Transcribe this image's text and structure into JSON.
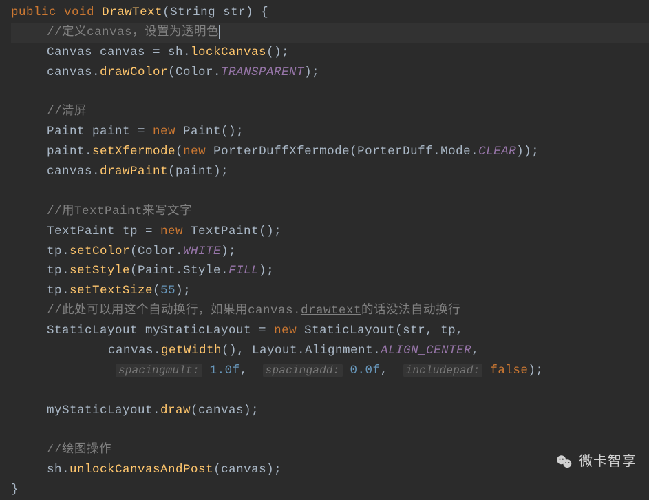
{
  "code": {
    "line1": {
      "kw1": "public",
      "kw2": "void",
      "method": "DrawText",
      "params": "(String str) {"
    },
    "comment1": "//定义canvas，设置为透明色",
    "line3": {
      "p1": "Canvas canvas = sh.",
      "m1": "lockCanvas",
      "p2": "();"
    },
    "line4": {
      "p1": "canvas.",
      "m1": "drawColor",
      "p2": "(Color.",
      "const1": "TRANSPARENT",
      "p3": ");"
    },
    "comment2": "//清屏",
    "line7": {
      "p1": "Paint paint = ",
      "kw1": "new",
      "p2": " Paint();"
    },
    "line8": {
      "p1": "paint.",
      "m1": "setXfermode",
      "p2": "(",
      "kw1": "new",
      "p3": " PorterDuffXfermode(PorterDuff.Mode.",
      "const1": "CLEAR",
      "p4": "));"
    },
    "line9": {
      "p1": "canvas.",
      "m1": "drawPaint",
      "p2": "(paint);"
    },
    "comment3": "//用TextPaint来写文字",
    "line12": {
      "p1": "TextPaint tp = ",
      "kw1": "new",
      "p2": " TextPaint();"
    },
    "line13": {
      "p1": "tp.",
      "m1": "setColor",
      "p2": "(Color.",
      "const1": "WHITE",
      "p3": ");"
    },
    "line14": {
      "p1": "tp.",
      "m1": "setStyle",
      "p2": "(Paint.Style.",
      "const1": "FILL",
      "p3": ");"
    },
    "line15": {
      "p1": "tp.",
      "m1": "setTextSize",
      "p2": "(",
      "num1": "55",
      "p3": ");"
    },
    "comment4a": "//此处可以用这个自动换行，如果用canvas.",
    "comment4b": "drawtext",
    "comment4c": "的话没法自动换行",
    "line17": {
      "p1": "StaticLayout myStaticLayout = ",
      "kw1": "new",
      "p2": " StaticLayout(str, tp,"
    },
    "line18": {
      "p1": "canvas.",
      "m1": "getWidth",
      "p2": "(), Layout.Alignment.",
      "const1": "ALIGN_CENTER",
      "p3": ","
    },
    "line19": {
      "hint1": "spacingmult:",
      "num1": " 1.0f",
      "comma1": ",  ",
      "hint2": "spacingadd:",
      "num2": " 0.0f",
      "comma2": ",  ",
      "hint3": "includepad:",
      "bool1": " false",
      "p1": ");"
    },
    "line21": {
      "p1": "myStaticLayout.",
      "m1": "draw",
      "p2": "(canvas);"
    },
    "comment5": "//绘图操作",
    "line24": {
      "p1": "sh.",
      "m1": "unlockCanvasAndPost",
      "p2": "(canvas);"
    },
    "close": "}"
  },
  "watermark": "微卡智享"
}
